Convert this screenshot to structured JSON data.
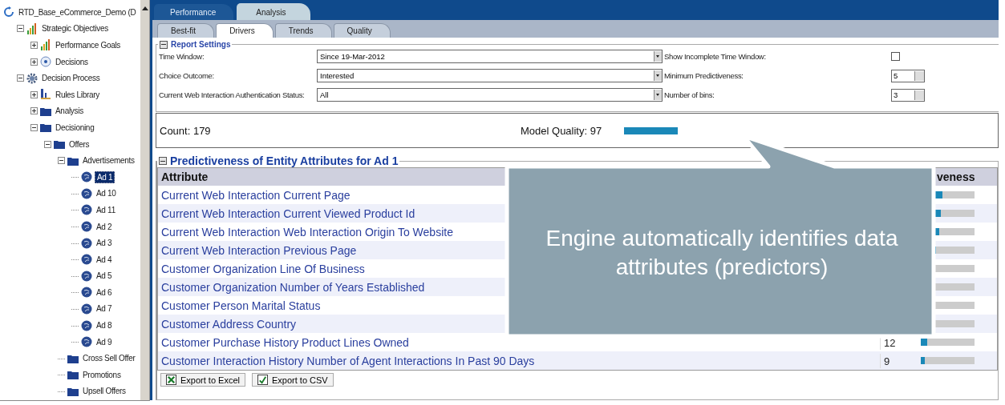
{
  "tree": [
    {
      "label": "RTD_Base_eCommerce_Demo (D",
      "kind": "root",
      "selected": false,
      "children": [
        {
          "label": "Strategic Objectives",
          "kind": "chart",
          "selected": false,
          "expanded": true,
          "children": [
            {
              "label": "Performance Goals",
              "kind": "chart",
              "selected": false,
              "expanded": false
            },
            {
              "label": "Decisions",
              "kind": "target",
              "selected": false,
              "expanded": false
            }
          ]
        },
        {
          "label": "Decision Process",
          "kind": "gear",
          "selected": false,
          "expanded": true,
          "children": [
            {
              "label": "Rules Library",
              "kind": "rules",
              "selected": false,
              "expanded": false
            },
            {
              "label": "Analysis",
              "kind": "folder",
              "selected": false,
              "expanded": false
            },
            {
              "label": "Decisioning",
              "kind": "folder",
              "selected": false,
              "expanded": true,
              "children": [
                {
                  "label": "Offers",
                  "kind": "folder",
                  "selected": false,
                  "expanded": true,
                  "children": [
                    {
                      "label": "Advertisements",
                      "kind": "folder",
                      "selected": false,
                      "expanded": true,
                      "children": [
                        {
                          "label": "Ad 1",
                          "kind": "ad",
                          "selected": true
                        },
                        {
                          "label": "Ad 10",
                          "kind": "ad",
                          "selected": false
                        },
                        {
                          "label": "Ad 11",
                          "kind": "ad",
                          "selected": false
                        },
                        {
                          "label": "Ad 2",
                          "kind": "ad",
                          "selected": false
                        },
                        {
                          "label": "Ad 3",
                          "kind": "ad",
                          "selected": false
                        },
                        {
                          "label": "Ad 4",
                          "kind": "ad",
                          "selected": false
                        },
                        {
                          "label": "Ad 5",
                          "kind": "ad",
                          "selected": false
                        },
                        {
                          "label": "Ad 6",
                          "kind": "ad",
                          "selected": false
                        },
                        {
                          "label": "Ad 7",
                          "kind": "ad",
                          "selected": false
                        },
                        {
                          "label": "Ad 8",
                          "kind": "ad",
                          "selected": false
                        },
                        {
                          "label": "Ad 9",
                          "kind": "ad",
                          "selected": false
                        }
                      ]
                    },
                    {
                      "label": "Cross Sell Offer",
                      "kind": "folder",
                      "selected": false
                    },
                    {
                      "label": "Promotions",
                      "kind": "folder",
                      "selected": false
                    },
                    {
                      "label": "Upsell Offers",
                      "kind": "folder",
                      "selected": false
                    }
                  ]
                }
              ]
            }
          ]
        }
      ]
    }
  ],
  "tabs": [
    {
      "label": "Performance",
      "selected": false
    },
    {
      "label": "Analysis",
      "selected": true
    }
  ],
  "subtabs": [
    {
      "label": "Best-fit",
      "selected": false
    },
    {
      "label": "Drivers",
      "selected": true
    },
    {
      "label": "Trends",
      "selected": false
    },
    {
      "label": "Quality",
      "selected": false
    }
  ],
  "report_settings": {
    "title": "Report Settings",
    "left": [
      {
        "label": "Time Window:",
        "value": "Since 19-Mar-2012"
      },
      {
        "label": "Choice Outcome:",
        "value": "Interested"
      },
      {
        "label": "Current Web Interaction Authentication Status:",
        "value": "All"
      }
    ],
    "right": [
      {
        "label": "Show Incomplete Time Window:",
        "kind": "checkbox",
        "checked": false
      },
      {
        "label": "Minimum Predictiveness:",
        "kind": "spinner",
        "value": "5"
      },
      {
        "label": "Number of bins:",
        "kind": "spinner",
        "value": "3"
      }
    ]
  },
  "summary": {
    "count": "Count: 179",
    "quality": "Model Quality: 97"
  },
  "predictiveness": {
    "title": "Predictiveness of Entity Attributes for Ad 1",
    "columns": [
      "Attribute",
      "veness"
    ],
    "rows": [
      {
        "attribute": "Current Web Interaction Current Page",
        "level": 0.4
      },
      {
        "attribute": "Current Web Interaction Current Viewed Product Id",
        "level": 0.37
      },
      {
        "attribute": "Current Web Interaction Web Interaction Origin To Website",
        "level": 0.35
      },
      {
        "attribute": "Current Web Interaction Previous Page",
        "level": 0.28
      },
      {
        "attribute": "Customer Organization Line Of Business"
      },
      {
        "attribute": "Customer Organization Number of Years Established"
      },
      {
        "attribute": "Customer Person Marital Status"
      },
      {
        "attribute": "Customer Address Country"
      },
      {
        "attribute": "Customer Purchase History Product Lines Owned",
        "value": "12",
        "level": 0.12
      },
      {
        "attribute": "Customer Interaction History Number of Agent Interactions In Past 90 Days",
        "value": "9",
        "level": 0.07
      }
    ],
    "buttons": [
      {
        "label": "Export to Excel",
        "kind": "excel"
      },
      {
        "label": "Export to CSV",
        "kind": "csv"
      }
    ]
  },
  "callout": {
    "text": "Engine automatically identifies data attributes (predictors)"
  }
}
